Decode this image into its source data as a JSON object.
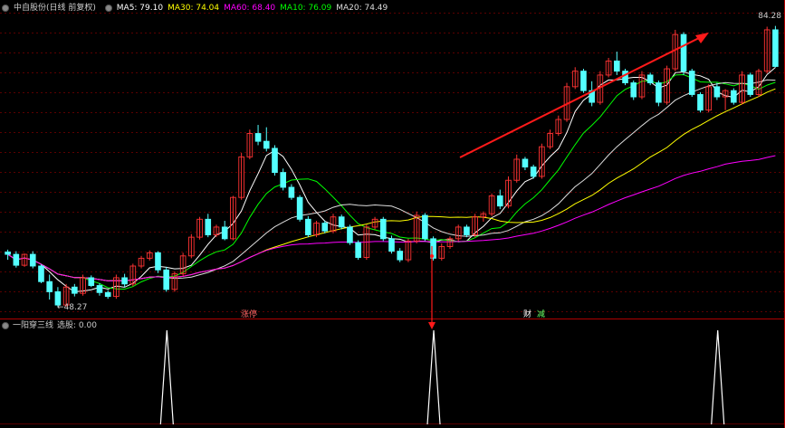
{
  "header": {
    "title": "中自股份(日线 前复权)",
    "ma_items": [
      {
        "label": "MA5: 79.10",
        "color": "#ffffff"
      },
      {
        "label": "MA30: 74.04",
        "color": "#ffff00"
      },
      {
        "label": "MA60: 68.40",
        "color": "#ff00ff"
      },
      {
        "label": "MA10: 76.09",
        "color": "#00ff00"
      },
      {
        "label": "MA20: 74.49",
        "color": "#dddddd"
      }
    ]
  },
  "sub_header": {
    "title": "一阳穿三线",
    "value_label": "选股: 0.00"
  },
  "labels": {
    "price_max": "84.28",
    "price_min": "48.27",
    "tag_1": "涨停",
    "tag_2": "财",
    "tag_3": "减"
  },
  "colors": {
    "background": "#000000",
    "grid": "#7a0000",
    "up": "#ff3333",
    "down": "#54ffff",
    "divider": "#b00000",
    "arrow": "#ff1a1a",
    "signal": "#ffffff"
  },
  "chart_data": {
    "type": "candlestick",
    "y_range": [
      47,
      86
    ],
    "max_label": 84.28,
    "min_label": 48.27,
    "candles_ohlc": [
      [
        55.3,
        55.6,
        54.3,
        55.0
      ],
      [
        55.0,
        55.4,
        53.3,
        53.6
      ],
      [
        53.6,
        55.1,
        53.4,
        55.0
      ],
      [
        55.0,
        55.4,
        53.2,
        53.5
      ],
      [
        53.5,
        53.7,
        51.3,
        51.5
      ],
      [
        51.5,
        52.4,
        49.2,
        50.2
      ],
      [
        50.2,
        50.8,
        48.3,
        48.5
      ],
      [
        48.5,
        51.2,
        48.3,
        50.8
      ],
      [
        50.8,
        51.2,
        49.6,
        50.0
      ],
      [
        50.0,
        52.4,
        49.7,
        52.0
      ],
      [
        52.0,
        52.3,
        50.8,
        51.0
      ],
      [
        51.0,
        51.3,
        49.7,
        50.1
      ],
      [
        50.1,
        50.4,
        49.3,
        49.6
      ],
      [
        49.6,
        52.4,
        49.3,
        52.0
      ],
      [
        52.0,
        52.5,
        50.8,
        51.2
      ],
      [
        51.2,
        53.8,
        50.9,
        53.5
      ],
      [
        53.5,
        54.8,
        53.2,
        54.5
      ],
      [
        54.5,
        55.5,
        54.2,
        55.2
      ],
      [
        55.2,
        55.4,
        52.6,
        53.0
      ],
      [
        53.0,
        53.4,
        50.2,
        50.5
      ],
      [
        50.5,
        52.8,
        50.2,
        52.5
      ],
      [
        52.5,
        55.2,
        52.2,
        54.8
      ],
      [
        54.8,
        57.6,
        54.5,
        57.2
      ],
      [
        57.2,
        59.8,
        56.9,
        59.5
      ],
      [
        59.5,
        60.2,
        57.2,
        57.5
      ],
      [
        57.5,
        58.8,
        57.2,
        58.5
      ],
      [
        58.5,
        59.3,
        56.8,
        57.0
      ],
      [
        57.0,
        62.5,
        56.8,
        62.3
      ],
      [
        62.3,
        68.0,
        62.0,
        67.5
      ],
      [
        67.5,
        71.0,
        67.2,
        70.5
      ],
      [
        70.5,
        71.6,
        69.0,
        69.5
      ],
      [
        69.5,
        71.3,
        68.2,
        68.6
      ],
      [
        68.6,
        69.0,
        65.1,
        65.5
      ],
      [
        65.5,
        66.0,
        63.2,
        63.6
      ],
      [
        63.6,
        64.0,
        62.0,
        62.3
      ],
      [
        62.3,
        62.6,
        59.2,
        59.5
      ],
      [
        59.5,
        59.9,
        57.2,
        57.5
      ],
      [
        57.5,
        59.3,
        57.2,
        59.0
      ],
      [
        59.0,
        59.3,
        57.7,
        58.0
      ],
      [
        58.0,
        60.2,
        57.7,
        59.8
      ],
      [
        59.8,
        60.1,
        58.2,
        58.5
      ],
      [
        58.5,
        58.8,
        56.2,
        56.5
      ],
      [
        56.5,
        56.8,
        54.3,
        54.6
      ],
      [
        54.6,
        58.8,
        54.3,
        58.5
      ],
      [
        58.5,
        59.8,
        58.2,
        59.5
      ],
      [
        59.5,
        59.8,
        56.7,
        57.0
      ],
      [
        57.0,
        57.4,
        55.1,
        55.4
      ],
      [
        55.4,
        55.8,
        54.0,
        54.3
      ],
      [
        54.3,
        57.0,
        54.0,
        56.7
      ],
      [
        56.7,
        60.5,
        56.4,
        60.0
      ],
      [
        60.0,
        60.3,
        56.7,
        57.0
      ],
      [
        57.0,
        57.3,
        54.2,
        54.5
      ],
      [
        54.5,
        56.4,
        54.2,
        56.0
      ],
      [
        56.0,
        57.3,
        55.7,
        57.0
      ],
      [
        57.0,
        58.8,
        56.7,
        58.5
      ],
      [
        58.5,
        58.8,
        57.2,
        57.5
      ],
      [
        57.5,
        60.2,
        57.2,
        59.8
      ],
      [
        59.8,
        60.5,
        59.2,
        60.2
      ],
      [
        60.2,
        62.8,
        59.9,
        62.5
      ],
      [
        62.5,
        63.3,
        60.8,
        61.2
      ],
      [
        61.2,
        65.0,
        60.9,
        64.5
      ],
      [
        64.5,
        67.8,
        64.2,
        67.2
      ],
      [
        67.2,
        67.5,
        65.8,
        66.2
      ],
      [
        66.2,
        66.5,
        64.7,
        65.0
      ],
      [
        65.0,
        69.2,
        64.7,
        68.8
      ],
      [
        68.8,
        71.0,
        68.5,
        70.5
      ],
      [
        70.5,
        72.8,
        70.2,
        72.3
      ],
      [
        72.3,
        77.0,
        72.0,
        76.5
      ],
      [
        76.5,
        79.0,
        76.2,
        78.5
      ],
      [
        78.5,
        78.8,
        75.7,
        76.0
      ],
      [
        76.0,
        77.2,
        74.0,
        74.5
      ],
      [
        74.5,
        78.5,
        74.2,
        78.0
      ],
      [
        78.0,
        80.2,
        77.7,
        79.8
      ],
      [
        79.8,
        81.0,
        78.0,
        78.5
      ],
      [
        78.5,
        78.8,
        76.7,
        77.0
      ],
      [
        77.0,
        77.3,
        74.8,
        75.2
      ],
      [
        75.2,
        78.5,
        74.9,
        78.0
      ],
      [
        78.0,
        78.3,
        76.7,
        77.0
      ],
      [
        77.0,
        77.3,
        74.0,
        74.5
      ],
      [
        74.5,
        79.2,
        74.2,
        78.8
      ],
      [
        78.8,
        83.8,
        78.5,
        83.2
      ],
      [
        83.2,
        83.5,
        78.0,
        78.5
      ],
      [
        78.5,
        78.8,
        75.2,
        75.5
      ],
      [
        75.5,
        75.8,
        73.2,
        73.5
      ],
      [
        73.5,
        76.8,
        73.2,
        76.5
      ],
      [
        76.5,
        77.0,
        74.8,
        75.2
      ],
      [
        75.2,
        76.2,
        73.5,
        76.0
      ],
      [
        76.0,
        76.3,
        74.2,
        74.5
      ],
      [
        74.5,
        78.5,
        74.2,
        78.0
      ],
      [
        78.0,
        78.3,
        75.2,
        75.5
      ],
      [
        75.5,
        78.8,
        75.2,
        78.5
      ],
      [
        78.5,
        84.2,
        78.2,
        83.8
      ],
      [
        83.8,
        84.3,
        79.0,
        79.1
      ]
    ],
    "signal_candle_indices": [
      15,
      66,
      131
    ],
    "signal_x_fraction": [
      0.2126,
      0.5525,
      0.9143
    ],
    "series": [
      {
        "name": "MA5",
        "color": "#ffffff"
      },
      {
        "name": "MA10",
        "color": "#00ff00"
      },
      {
        "name": "MA20",
        "color": "#dddddd"
      },
      {
        "name": "MA30",
        "color": "#ffff00"
      },
      {
        "name": "MA60",
        "color": "#ff00ff"
      }
    ],
    "annotations": [
      "涨停",
      "财",
      "减"
    ]
  }
}
